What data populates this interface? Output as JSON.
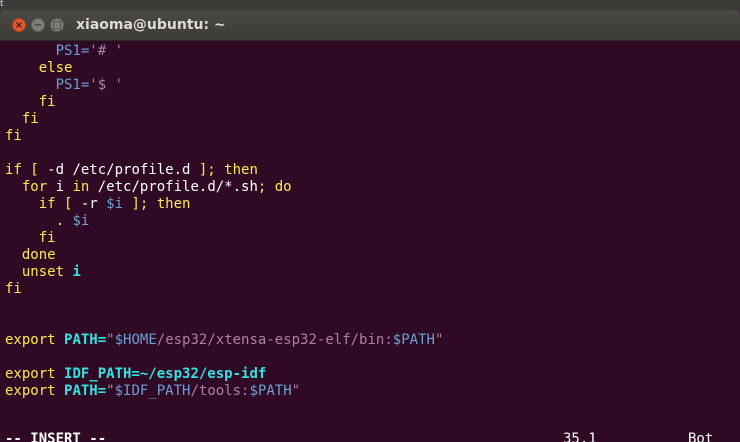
{
  "desktop": {
    "corner_glyph": "t"
  },
  "window": {
    "title": "xiaoma@ubuntu: ~",
    "close_glyph": "×",
    "minimize_glyph": "−",
    "maximize_glyph": "□"
  },
  "editor": {
    "lines": [
      [
        {
          "t": "      "
        },
        {
          "t": "PS1=",
          "c": "var"
        },
        {
          "t": "'# '",
          "c": "str"
        }
      ],
      [
        {
          "t": "    "
        },
        {
          "t": "else",
          "c": "kw"
        }
      ],
      [
        {
          "t": "      "
        },
        {
          "t": "PS1=",
          "c": "var"
        },
        {
          "t": "'$ '",
          "c": "str"
        }
      ],
      [
        {
          "t": "    "
        },
        {
          "t": "fi",
          "c": "kw"
        }
      ],
      [
        {
          "t": "  "
        },
        {
          "t": "fi",
          "c": "kw"
        }
      ],
      [
        {
          "t": "fi",
          "c": "kw"
        }
      ],
      [],
      [
        {
          "t": "if [ ",
          "c": "kw"
        },
        {
          "t": "-d /etc/profile.d ",
          "c": "pl"
        },
        {
          "t": "]; then",
          "c": "kw"
        }
      ],
      [
        {
          "t": "  "
        },
        {
          "t": "for",
          "c": "kw"
        },
        {
          "t": " i ",
          "c": "pl"
        },
        {
          "t": "in",
          "c": "kw"
        },
        {
          "t": " /etc/profile.d/*.sh",
          "c": "pl"
        },
        {
          "t": "; do",
          "c": "kw"
        }
      ],
      [
        {
          "t": "    "
        },
        {
          "t": "if [ ",
          "c": "kw"
        },
        {
          "t": "-r ",
          "c": "pl"
        },
        {
          "t": "$i",
          "c": "var"
        },
        {
          "t": " ]; then",
          "c": "kw"
        }
      ],
      [
        {
          "t": "      "
        },
        {
          "t": ". ",
          "c": "kw"
        },
        {
          "t": "$i",
          "c": "var"
        }
      ],
      [
        {
          "t": "    "
        },
        {
          "t": "fi",
          "c": "kw"
        }
      ],
      [
        {
          "t": "  "
        },
        {
          "t": "done",
          "c": "kw"
        }
      ],
      [
        {
          "t": "  "
        },
        {
          "t": "unset",
          "c": "kw"
        },
        {
          "t": " "
        },
        {
          "t": "i",
          "c": "id"
        }
      ],
      [
        {
          "t": "fi",
          "c": "kw"
        }
      ],
      [],
      [],
      [
        {
          "t": "export",
          "c": "kw"
        },
        {
          "t": " "
        },
        {
          "t": "PATH=",
          "c": "id"
        },
        {
          "t": "\"",
          "c": "str"
        },
        {
          "t": "$HOME",
          "c": "var"
        },
        {
          "t": "/esp32/xtensa-esp32-elf/bin:",
          "c": "str"
        },
        {
          "t": "$PATH",
          "c": "var"
        },
        {
          "t": "\"",
          "c": "str"
        }
      ],
      [],
      [
        {
          "t": "export",
          "c": "kw"
        },
        {
          "t": " "
        },
        {
          "t": "IDF_PATH=~/esp32/esp-idf",
          "c": "id"
        }
      ],
      [
        {
          "t": "export",
          "c": "kw"
        },
        {
          "t": " "
        },
        {
          "t": "PATH=",
          "c": "id"
        },
        {
          "t": "\"",
          "c": "str"
        },
        {
          "t": "$IDF_PATH",
          "c": "var"
        },
        {
          "t": "/tools:",
          "c": "str"
        },
        {
          "t": "$PATH",
          "c": "var"
        },
        {
          "t": "\"",
          "c": "str"
        }
      ]
    ]
  },
  "statusline": {
    "mode": "-- INSERT --",
    "position": "35,1",
    "scroll": "Bot"
  },
  "colors": {
    "terminal_background": "#300a24",
    "keyword": "#fce94f",
    "string": "#ad7fa8",
    "variable": "#6a9fd8",
    "identifier": "#34e2e2",
    "close_button": "#e4572e"
  }
}
